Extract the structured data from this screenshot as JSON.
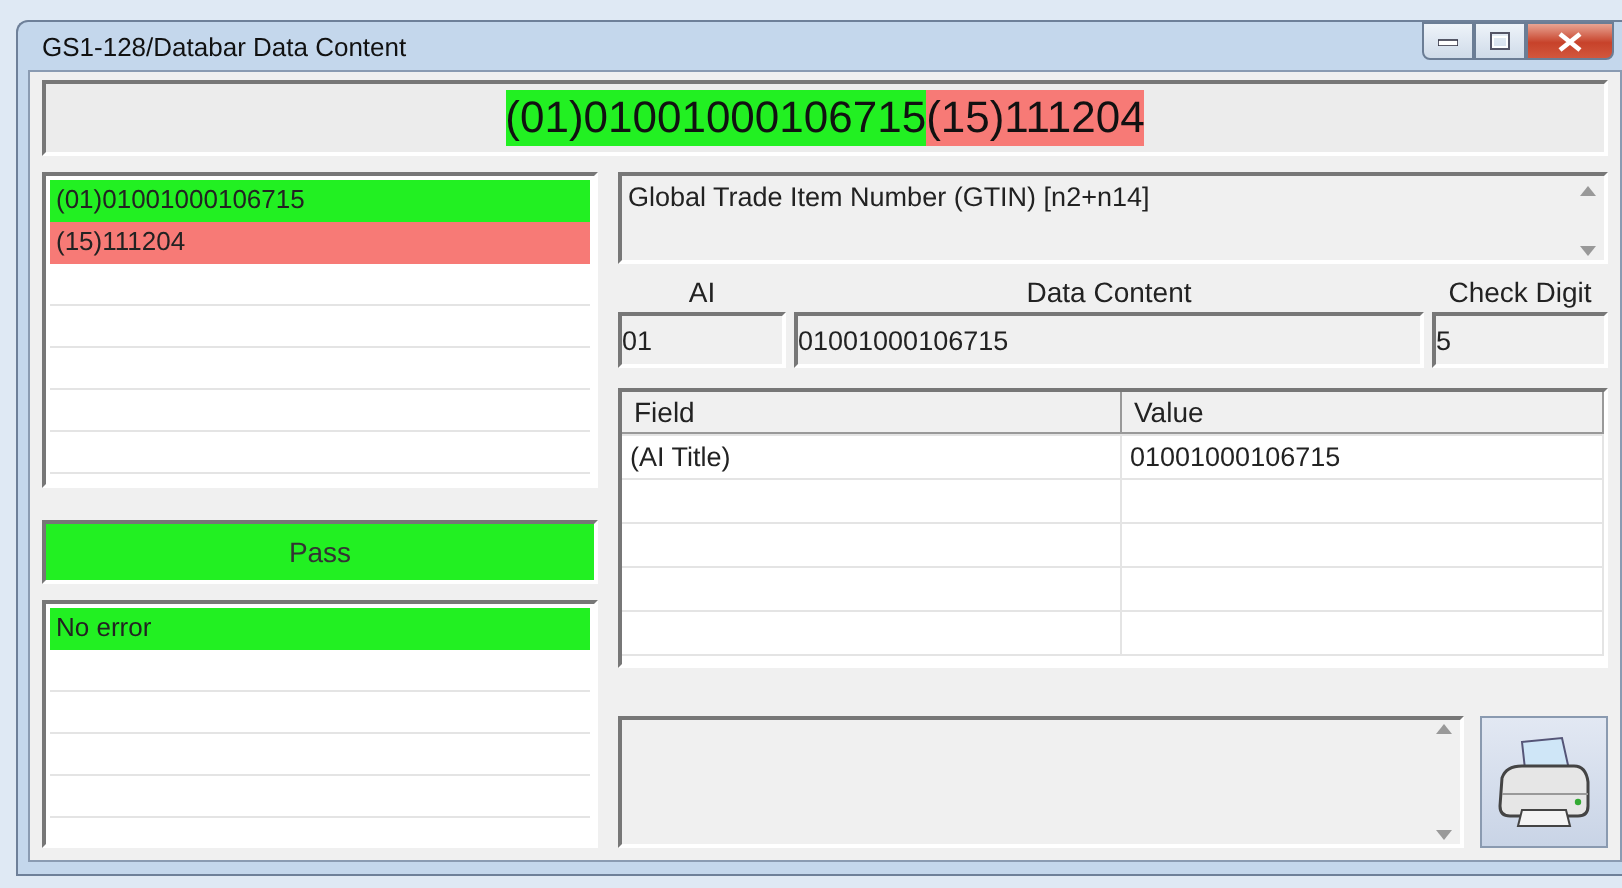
{
  "window": {
    "title": "GS1-128/Databar Data Content"
  },
  "barcode_segments": [
    {
      "text": "(01)01001000106715",
      "color": "#22f022"
    },
    {
      "text": "(15)111204",
      "color": "#f77a76"
    }
  ],
  "ai_list": [
    {
      "text": "(01)01001000106715",
      "color": "#22f022"
    },
    {
      "text": "(15)111204",
      "color": "#f77a76"
    }
  ],
  "status": {
    "text": "Pass",
    "color": "#22f022"
  },
  "errors": [
    {
      "text": "No error",
      "color": "#22f022"
    }
  ],
  "description": "Global Trade Item Number (GTIN) [n2+n14]",
  "ai_label": "AI",
  "ai_value": "01",
  "content_label": "Data Content",
  "content_value": "01001000106715",
  "check_label": "Check Digit",
  "check_value": "5",
  "table": {
    "columns": [
      "Field",
      "Value"
    ],
    "rows": [
      [
        "(AI Title)",
        "01001000106715"
      ]
    ]
  }
}
